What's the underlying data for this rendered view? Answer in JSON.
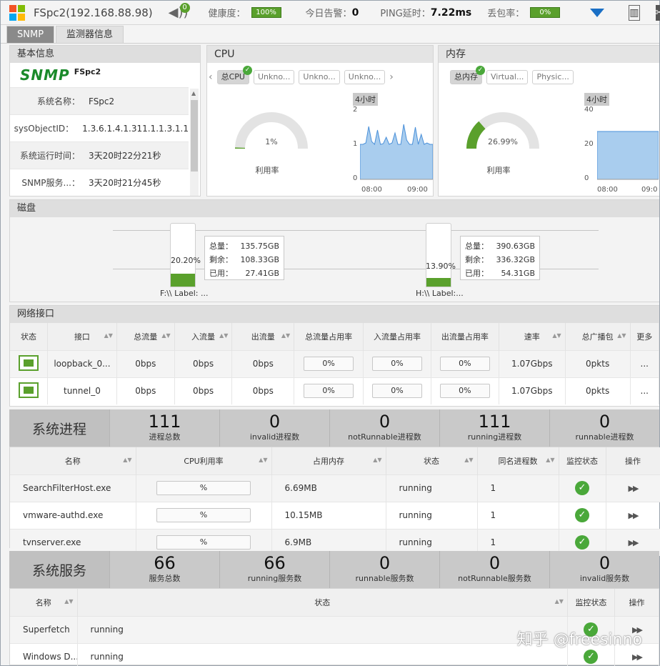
{
  "topbar": {
    "title": "FSpc2(192.168.88.98)",
    "sound_badge": "0",
    "health_label": "健康度：",
    "health_value": "100%",
    "alerts_label": "今日告警：",
    "alerts_value": "0",
    "ping_label": "PING延时：",
    "ping_value": "7.22ms",
    "loss_label": "丢包率：",
    "loss_value": "0%",
    "icons": [
      "windows-logo-icon",
      "sound-icon",
      "dropdown-triangle-icon",
      "chart-icon",
      "tools-icon"
    ],
    "colors": {
      "ok_green": "#5aa02c",
      "accent_blue": "#1a6fc5"
    }
  },
  "tabs": [
    {
      "label": "SNMP",
      "active": true
    },
    {
      "label": "监测器信息",
      "active": false
    }
  ],
  "basic": {
    "title": "基本信息",
    "logo_text": "SNMP",
    "logo_sub": "FSpc2",
    "rows": [
      {
        "k": "系统名称：",
        "v": "FSpc2"
      },
      {
        "k": "sysObjectID：",
        "v": "1.3.6.1.4.1.311.1.1.3.1.1"
      },
      {
        "k": "系统运行时间：",
        "v": "3天20时22分21秒"
      },
      {
        "k": "SNMP服务...：",
        "v": "3天20时21分45秒"
      }
    ]
  },
  "cpu": {
    "title": "CPU",
    "chips": [
      "总CPU",
      "Unkno...",
      "Unkno...",
      "Unkno..."
    ],
    "gauge_value": "1%",
    "gauge_fraction": 0.01,
    "gauge_label": "利用率",
    "range": "4小时",
    "y_ticks": [
      "2",
      "1",
      "0"
    ],
    "x_ticks": [
      "08:00",
      "09:00"
    ]
  },
  "mem": {
    "title": "内存",
    "chips": [
      "总内存",
      "Virtual...",
      "Physic..."
    ],
    "gauge_value": "26.99%",
    "gauge_fraction": 0.2699,
    "gauge_label": "利用率",
    "range": "4小时",
    "y_ticks": [
      "40",
      "20",
      "0"
    ],
    "x_ticks": [
      "08:00",
      "09:0"
    ]
  },
  "disk": {
    "title": "磁盘",
    "drives": [
      {
        "label": "F:\\\\ Label: ...",
        "pct": "20.20%",
        "fraction": 0.202,
        "total_k": "总量：",
        "total": "135.75GB",
        "free_k": "剩余：",
        "free": "108.33GB",
        "used_k": "已用：",
        "used": "27.41GB"
      },
      {
        "label": "H:\\\\ Label:...",
        "pct": "13.90%",
        "fraction": 0.139,
        "total_k": "总量：",
        "total": "390.63GB",
        "free_k": "剩余：",
        "free": "336.32GB",
        "used_k": "已用：",
        "used": "54.31GB"
      }
    ]
  },
  "network": {
    "title": "网络接口",
    "columns": [
      "状态",
      "接口",
      "总流量",
      "入流量",
      "出流量",
      "总流量占用率",
      "入流量占用率",
      "出流量占用率",
      "速率",
      "总广播包",
      "更多"
    ],
    "rows": [
      {
        "iface": "loopback_0...",
        "total": "0bps",
        "in": "0bps",
        "out": "0bps",
        "tp": "0%",
        "ip": "0%",
        "op": "0%",
        "speed": "1.07Gbps",
        "bcast": "0pkts",
        "more": "..."
      },
      {
        "iface": "tunnel_0",
        "total": "0bps",
        "in": "0bps",
        "out": "0bps",
        "tp": "0%",
        "ip": "0%",
        "op": "0%",
        "speed": "1.07Gbps",
        "bcast": "0pkts",
        "more": "..."
      }
    ]
  },
  "proc_summary": {
    "title": "系统进程",
    "cells": [
      {
        "n": "111",
        "l": "进程总数"
      },
      {
        "n": "0",
        "l": "invalid进程数"
      },
      {
        "n": "0",
        "l": "notRunnable进程数"
      },
      {
        "n": "111",
        "l": "running进程数"
      },
      {
        "n": "0",
        "l": "runnable进程数"
      }
    ]
  },
  "processes": {
    "columns": [
      "名称",
      "CPU利用率",
      "占用内存",
      "状态",
      "同名进程数",
      "监控状态",
      "操作"
    ],
    "rows": [
      {
        "name": "SearchFilterHost.exe",
        "cpu": "%",
        "mem": "6.69MB",
        "state": "running",
        "count": "1"
      },
      {
        "name": "vmware-authd.exe",
        "cpu": "%",
        "mem": "10.15MB",
        "state": "running",
        "count": "1"
      },
      {
        "name": "tvnserver.exe",
        "cpu": "%",
        "mem": "6.9MB",
        "state": "running",
        "count": "1"
      }
    ]
  },
  "svc_summary": {
    "title": "系统服务",
    "cells": [
      {
        "n": "66",
        "l": "服务总数"
      },
      {
        "n": "66",
        "l": "running服务数"
      },
      {
        "n": "0",
        "l": "runnable服务数"
      },
      {
        "n": "0",
        "l": "notRunnable服务数"
      },
      {
        "n": "0",
        "l": "invalid服务数"
      }
    ]
  },
  "services": {
    "columns": [
      "名称",
      "状态",
      "监控状态",
      "操作"
    ],
    "rows": [
      {
        "name": "Superfetch",
        "state": "running"
      },
      {
        "name": "Windows D...",
        "state": "running"
      }
    ]
  },
  "watermark": "知乎 @freesinno"
}
